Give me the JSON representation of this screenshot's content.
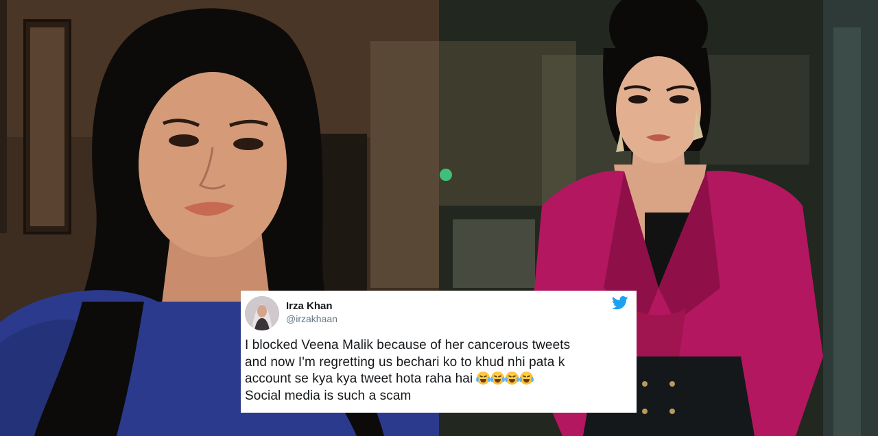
{
  "tweet": {
    "name": "Irza Khan",
    "handle": "@irzakhaan",
    "lines": [
      "I blocked Veena Malik because of her cancerous tweets",
      "and now I'm regretting us bechari ko to khud nhi pata k",
      "account se kya kya tweet hota raha hai",
      "Social media is such a scam"
    ],
    "emoji_name": "face-with-tears-of-joy",
    "emoji_count": 4
  },
  "colors": {
    "twitter_blue": "#1da1f2",
    "handle_gray": "#657786",
    "text": "#14171a",
    "left_dress": "#2b3a8c",
    "right_top": "#b3175f"
  },
  "icons": {
    "brand": "twitter-bird-icon"
  }
}
